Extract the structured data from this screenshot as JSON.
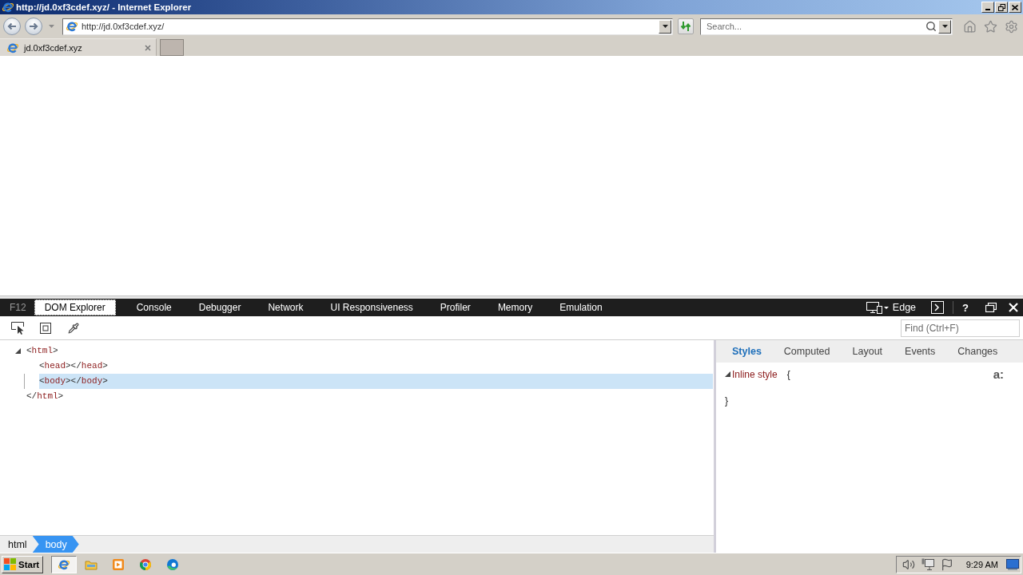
{
  "window": {
    "title": "http://jd.0xf3cdef.xyz/ - Internet Explorer"
  },
  "address_bar": {
    "value": "http://jd.0xf3cdef.xyz/"
  },
  "search": {
    "placeholder": "Search..."
  },
  "tabs": [
    {
      "label": "jd.0xf3cdef.xyz",
      "selected": true
    }
  ],
  "devtools": {
    "f12_label": "F12",
    "tabs": [
      {
        "label": "DOM Explorer",
        "selected": true
      },
      {
        "label": "Console",
        "selected": false
      },
      {
        "label": "Debugger",
        "selected": false
      },
      {
        "label": "Network",
        "selected": false
      },
      {
        "label": "UI Responsiveness",
        "selected": false
      },
      {
        "label": "Profiler",
        "selected": false
      },
      {
        "label": "Memory",
        "selected": false
      },
      {
        "label": "Emulation",
        "selected": false
      }
    ],
    "document_mode": "Edge",
    "help_label": "?",
    "find": {
      "placeholder": "Find (Ctrl+F)"
    },
    "dom_tree": [
      {
        "text": "<html>",
        "closing_text": "</html>",
        "expanded": true,
        "selected": false,
        "children": [
          {
            "text": "<head></head>",
            "selected": false
          },
          {
            "text": "<body></body>",
            "selected": true
          }
        ]
      }
    ],
    "breadcrumbs": [
      {
        "label": "html",
        "selected": false
      },
      {
        "label": "body",
        "selected": true
      }
    ],
    "style_tabs": [
      {
        "label": "Styles",
        "selected": true
      },
      {
        "label": "Computed",
        "selected": false
      },
      {
        "label": "Layout",
        "selected": false
      },
      {
        "label": "Events",
        "selected": false
      },
      {
        "label": "Changes",
        "selected": false
      }
    ],
    "style_rules": [
      {
        "selector": "Inline style",
        "expanded": true,
        "open_brace": "{",
        "close_brace": "}"
      }
    ],
    "pseudo_toggle": "a:"
  },
  "taskbar": {
    "start_label": "Start",
    "apps": [
      {
        "kind": "ie",
        "selected": true
      },
      {
        "kind": "folder",
        "selected": false
      },
      {
        "kind": "media",
        "selected": false
      },
      {
        "kind": "chrome",
        "selected": false
      },
      {
        "kind": "edge",
        "selected": false
      }
    ],
    "clock": "9:29 AM"
  }
}
